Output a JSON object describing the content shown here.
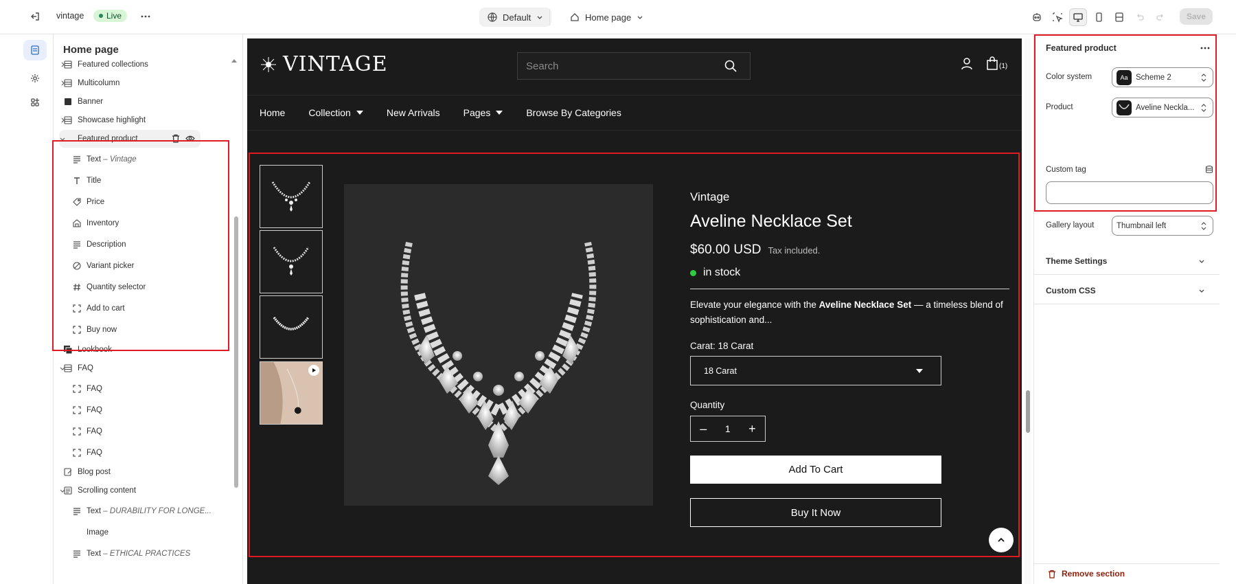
{
  "topbar": {
    "store_name": "vintage",
    "status_badge": "Live",
    "theme_label": "Default",
    "page_label": "Home page",
    "save_label": "Save"
  },
  "sidebar": {
    "title": "Home page",
    "items": [
      {
        "label": "Featured collections",
        "icon": "section-icon"
      },
      {
        "label": "Multicolumn",
        "icon": "section-icon"
      },
      {
        "label": "Banner",
        "icon": "image-block-icon"
      },
      {
        "label": "Showcase highlight",
        "icon": "section-icon"
      },
      {
        "label": "Featured product",
        "icon": "none"
      },
      {
        "label": "Text",
        "sub": "Vintage",
        "icon": "text-icon"
      },
      {
        "label": "Title",
        "icon": "title-icon"
      },
      {
        "label": "Price",
        "icon": "price-tag-icon"
      },
      {
        "label": "Inventory",
        "icon": "inventory-icon"
      },
      {
        "label": "Description",
        "icon": "text-icon"
      },
      {
        "label": "Variant picker",
        "icon": "variant-icon"
      },
      {
        "label": "Quantity selector",
        "icon": "hash-icon"
      },
      {
        "label": "Add to cart",
        "icon": "block-icon"
      },
      {
        "label": "Buy now",
        "icon": "block-icon"
      },
      {
        "label": "Lookbook",
        "icon": "lookbook-icon"
      },
      {
        "label": "FAQ",
        "icon": "section-icon"
      },
      {
        "label": "FAQ",
        "icon": "block-icon"
      },
      {
        "label": "FAQ",
        "icon": "block-icon"
      },
      {
        "label": "FAQ",
        "icon": "block-icon"
      },
      {
        "label": "FAQ",
        "icon": "block-icon"
      },
      {
        "label": "Blog post",
        "icon": "blog-icon"
      },
      {
        "label": "Scrolling content",
        "icon": "scroll-icon"
      },
      {
        "label": "Text",
        "sub": "DURABILITY FOR LONGE...",
        "icon": "text-icon"
      },
      {
        "label": "Image",
        "icon": "none"
      },
      {
        "label": "Text",
        "sub": "ETHICAL PRACTICES",
        "icon": "text-icon"
      }
    ]
  },
  "preview": {
    "logo_text": "VINTAGE",
    "search_placeholder": "Search",
    "cart_count": "(1)",
    "nav": [
      "Home",
      "Collection",
      "New Arrivals",
      "Pages",
      "Browse By Categories"
    ],
    "product": {
      "vendor": "Vintage",
      "title": "Aveline Necklace Set",
      "price": "$60.00 USD",
      "tax_note": "Tax included.",
      "stock": "in stock",
      "desc_pre": "Elevate your elegance with the ",
      "desc_bold": "Aveline Necklace Set",
      "desc_post": " — a timeless blend of sophistication and...",
      "variant_label": "Carat: 18 Carat",
      "variant_value": "18 Carat",
      "quantity_label": "Quantity",
      "quantity_value": "1",
      "add_to_cart": "Add To Cart",
      "buy_now": "Buy It Now"
    }
  },
  "panel": {
    "title": "Featured product",
    "color_system_label": "Color system",
    "color_system_value": "Scheme 2",
    "color_chip": "Aa",
    "product_label": "Product",
    "product_value": "Aveline Neckla...",
    "custom_tag_label": "Custom tag",
    "custom_tag_value": "",
    "gallery_label": "Gallery layout",
    "gallery_value": "Thumbnail left",
    "theme_settings": "Theme Settings",
    "custom_css": "Custom CSS",
    "remove_section": "Remove section"
  },
  "colors": {
    "accent": "#2c6ecb",
    "highlight": "#e01b24",
    "live": "#29845a",
    "store_bg": "#1b1b1b"
  }
}
